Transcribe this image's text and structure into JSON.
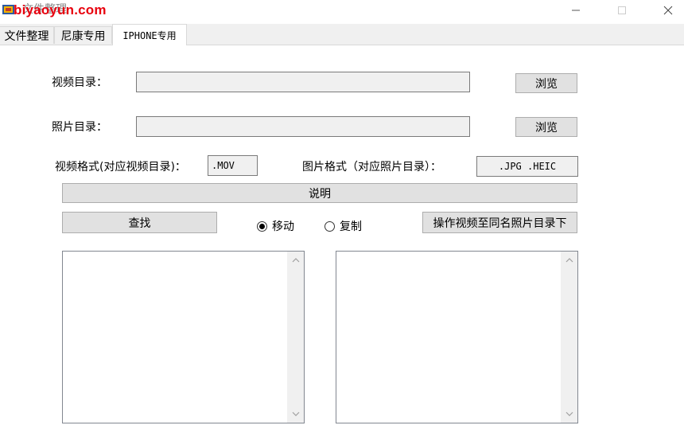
{
  "window": {
    "title": "文件整理",
    "watermark": "biyaoyun.com",
    "icon": "app-icon",
    "controls": [
      "minimize-icon",
      "maximize-icon",
      "close-icon"
    ]
  },
  "tabs": [
    {
      "label": "文件整理",
      "active": false
    },
    {
      "label": "尼康专用",
      "active": false
    },
    {
      "label": "IPHONE专用",
      "active": true
    }
  ],
  "form": {
    "video_dir_label": "视频目录：",
    "video_dir_value": "",
    "browse_label": "浏览",
    "photo_dir_label": "照片目录：",
    "photo_dir_value": "",
    "video_format_label": "视频格式(对应视频目录)：",
    "video_format_value": ".MOV",
    "image_format_label": "图片格式（对应照片目录）：",
    "image_format_value": ".JPG .HEIC"
  },
  "actions": {
    "description_label": "说明",
    "find_label": "查找",
    "move_label": "移动",
    "copy_label": "复制",
    "selected_mode": "move",
    "operate_label": "操作视频至同名照片目录下"
  },
  "lists": {
    "left_items": [],
    "right_items": []
  },
  "colors": {
    "watermark": "#e8000e",
    "button_bg": "#e1e1e1",
    "field_bg": "#f0f0f0"
  }
}
